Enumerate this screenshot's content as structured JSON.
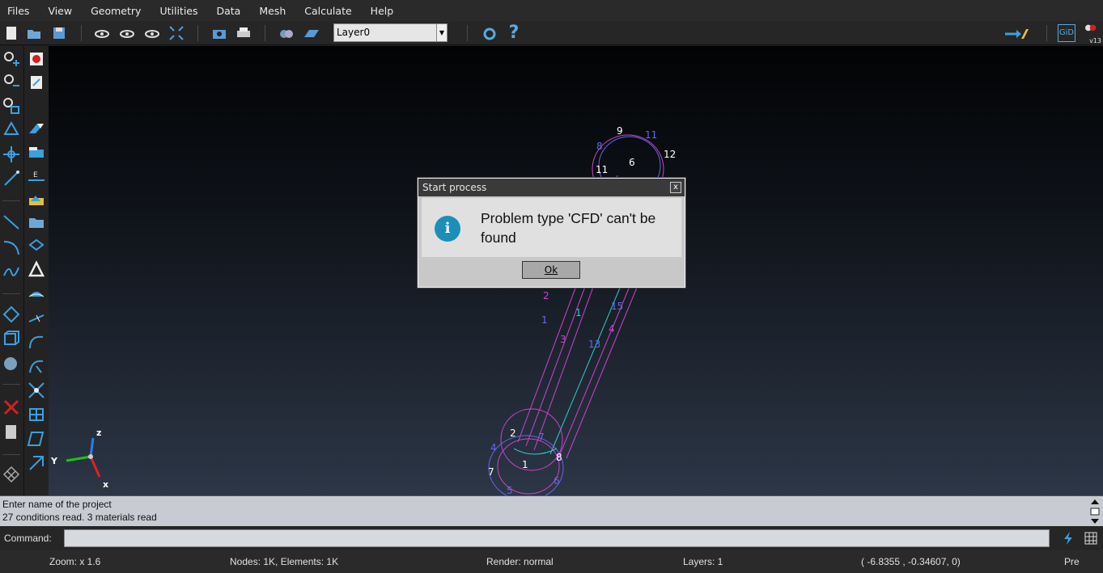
{
  "menu": [
    "Files",
    "View",
    "Geometry",
    "Utilities",
    "Data",
    "Mesh",
    "Calculate",
    "Help"
  ],
  "toolbar": {
    "layer_value": "Layer0",
    "right_badge": "GiD",
    "version": "v13"
  },
  "dialog": {
    "title": "Start process",
    "close_label": "x",
    "message": "Problem type 'CFD' can't be found",
    "ok_label": "Ok"
  },
  "viewport": {
    "axis_labels": {
      "z": "z",
      "y": "Y",
      "x": "x"
    },
    "point_labels": [
      "9",
      "11",
      "8",
      "12",
      "6",
      "11",
      "2",
      "1",
      "15",
      "1",
      "4",
      "3",
      "13",
      "2",
      "7",
      "4",
      "8",
      "1",
      "7",
      "5",
      "6"
    ]
  },
  "output": {
    "line1": "Enter name of the project",
    "line2": "27 conditions read. 3 materials read"
  },
  "command": {
    "label": "Command:"
  },
  "status": {
    "zoom": "Zoom: x 1.6",
    "nodes": "Nodes: 1K, Elements: 1K",
    "render": "Render: normal",
    "layers": "Layers: 1",
    "coords": "( -6.8355 , -0.34607,  0)",
    "mode": "Pre"
  },
  "colors": {
    "accent": "#1b8fb8",
    "magenta": "#cc33cc",
    "cyan": "#33cccc",
    "blue_label": "#5566ee"
  }
}
